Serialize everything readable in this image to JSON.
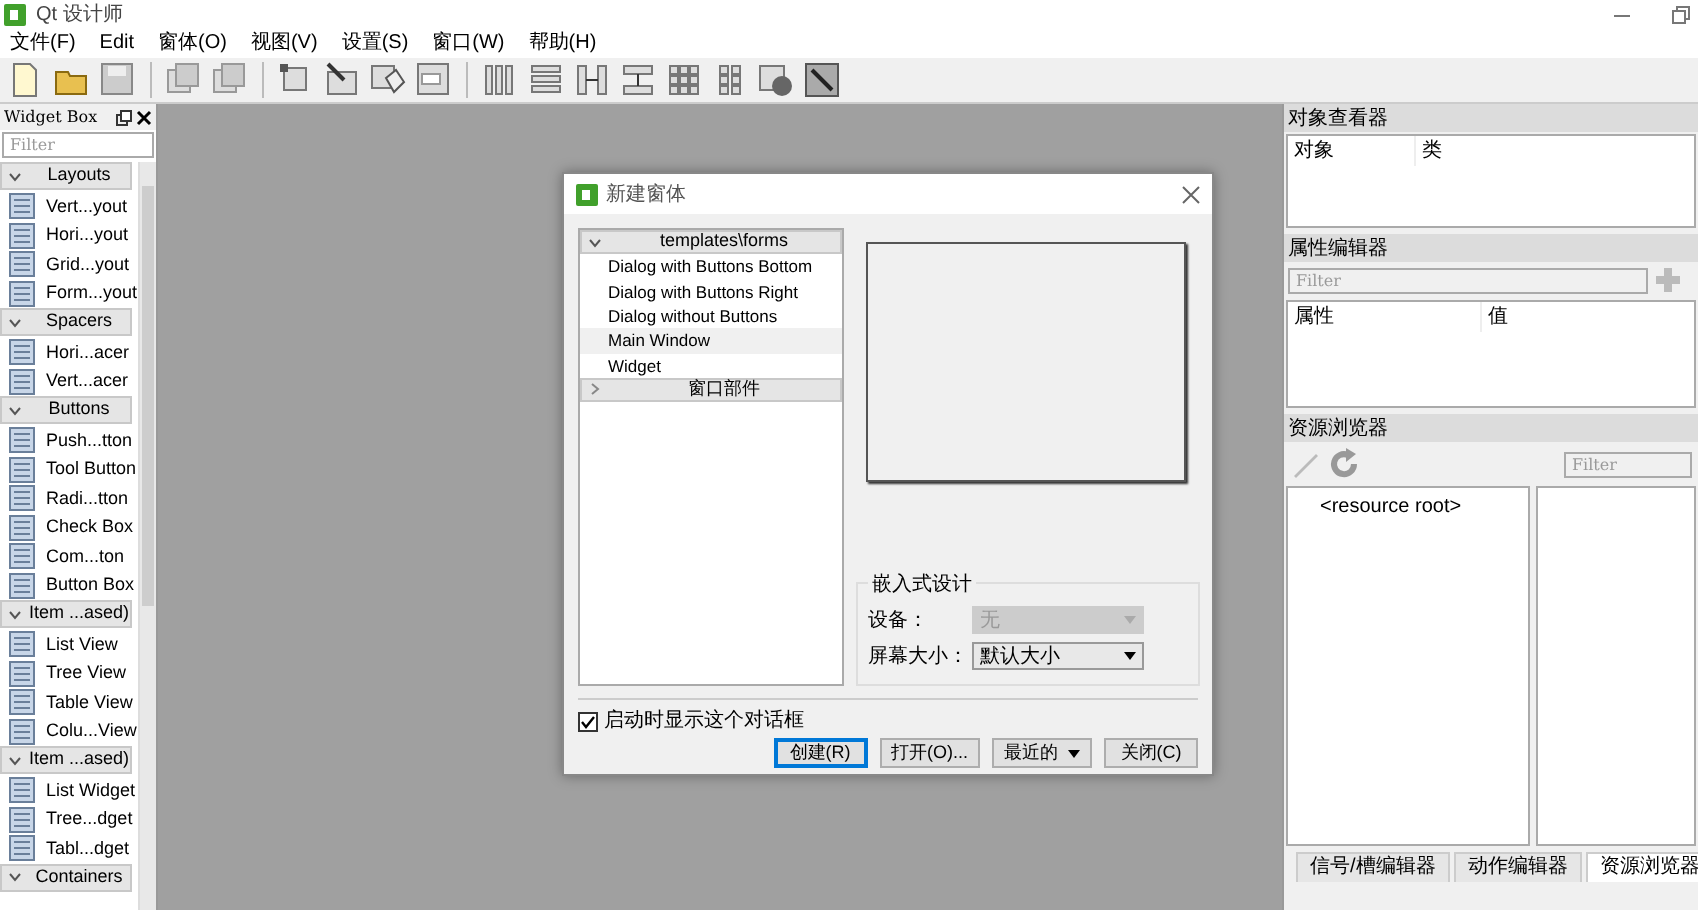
{
  "window": {
    "title": "Qt 设计师"
  },
  "menu": [
    "文件(F)",
    "Edit",
    "窗体(O)",
    "视图(V)",
    "设置(S)",
    "窗口(W)",
    "帮助(H)"
  ],
  "widget_box": {
    "title": "Widget Box",
    "filter": {
      "placeholder": "Filter"
    },
    "groups": [
      {
        "label": "Layouts",
        "expanded": true,
        "items": [
          "Vert...yout",
          "Hori...yout",
          "Grid...yout",
          "Form...yout"
        ]
      },
      {
        "label": "Spacers",
        "expanded": true,
        "items": [
          "Hori...acer",
          "Vert...acer"
        ]
      },
      {
        "label": "Buttons",
        "expanded": true,
        "items": [
          "Push...tton",
          "Tool Button",
          "Radi...tton",
          "Check Box",
          "Com...ton",
          "Button Box"
        ]
      },
      {
        "label": "Item ...ased)",
        "expanded": true,
        "items": [
          "List View",
          "Tree View",
          "Table View",
          "Colu...View"
        ]
      },
      {
        "label": "Item ...ased)",
        "expanded": true,
        "items": [
          "List Widget",
          "Tree...dget",
          "Tabl...dget"
        ]
      },
      {
        "label": "Containers",
        "expanded": true
      }
    ]
  },
  "dialog": {
    "title": "新建窗体",
    "templates": [
      {
        "label": "templates\\forms",
        "expanded": true,
        "children": [
          {
            "label": "Dialog with Buttons Bottom",
            "selected": false
          },
          {
            "label": "Dialog with Buttons Right",
            "selected": false
          },
          {
            "label": "Dialog without Buttons",
            "selected": false
          },
          {
            "label": "Main Window",
            "selected": true
          },
          {
            "label": "Widget",
            "selected": false
          }
        ]
      },
      {
        "label": "窗口部件",
        "expanded": false
      }
    ],
    "embedded": {
      "title": "嵌入式设计",
      "fields": [
        {
          "label": "设备：",
          "value": "无",
          "disabled": true
        },
        {
          "label": "屏幕大小：",
          "value": "默认大小",
          "disabled": false
        }
      ]
    },
    "show_on_startup": {
      "label": "启动时显示这个对话框",
      "checked": true
    },
    "buttons": [
      {
        "label": "创建(R)",
        "kind": "default"
      },
      {
        "label": "打开(O)...",
        "kind": "plain"
      },
      {
        "label": "最近的",
        "kind": "menu"
      },
      {
        "label": "关闭(C)",
        "kind": "plain"
      }
    ]
  },
  "object_inspector": {
    "title": "对象查看器",
    "columns": [
      "对象",
      "类"
    ]
  },
  "property_editor": {
    "title": "属性编辑器",
    "filter": {
      "placeholder": "Filter"
    },
    "columns": [
      "属性",
      "值"
    ]
  },
  "resource_browser": {
    "title": "资源浏览器",
    "filter": {
      "placeholder": "Filter"
    },
    "root": "<resource root>"
  },
  "bottom_tabs": [
    {
      "label": "信号/槽编辑器",
      "selected": false
    },
    {
      "label": "动作编辑器",
      "selected": false
    },
    {
      "label": "资源浏览器",
      "selected": true
    }
  ]
}
